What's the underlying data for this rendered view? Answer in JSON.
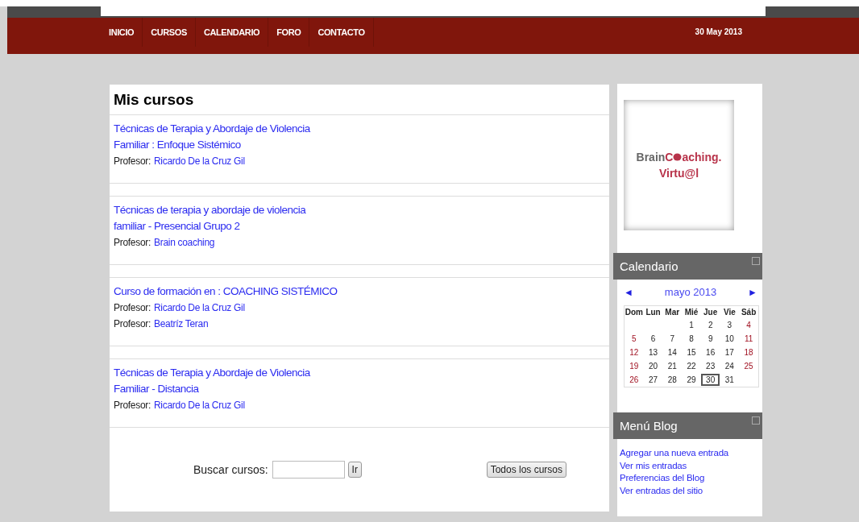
{
  "nav": {
    "items": [
      {
        "label": "INICIO"
      },
      {
        "label": "CURSOS"
      },
      {
        "label": "CALENDARIO"
      },
      {
        "label": "FORO"
      },
      {
        "label": "CONTACTO"
      }
    ],
    "date": "30 May 2013"
  },
  "courses": {
    "title": "Mis cursos",
    "items": [
      {
        "title_lines": [
          "Técnicas de Terapia y Abordaje de Violencia",
          "Familiar : Enfoque Sistémico"
        ],
        "teachers": [
          {
            "label": "Profesor:",
            "name": "Ricardo De la Cruz Gil"
          }
        ]
      },
      {
        "title_lines": [
          "Técnicas de terapia y abordaje de violencia",
          "familiar - Presencial Grupo 2"
        ],
        "teachers": [
          {
            "label": "Profesor:",
            "name": "Brain coaching"
          }
        ]
      },
      {
        "title_lines": [
          "Curso de formación en : COACHING SISTÉMICO"
        ],
        "teachers": [
          {
            "label": "Profesor:",
            "name": "Ricardo De la Cruz Gil"
          },
          {
            "label": "Profesor:",
            "name": "Beatríz Teran"
          }
        ]
      },
      {
        "title_lines": [
          "Técnicas de Terapia y Abordaje de Violencia",
          "Familiar - Distancia"
        ],
        "teachers": [
          {
            "label": "Profesor:",
            "name": "Ricardo De la Cruz Gil"
          }
        ]
      }
    ],
    "search": {
      "label": "Buscar cursos:",
      "button": "Ir"
    },
    "all_button": "Todos los cursos"
  },
  "logo": {
    "brand_start": "Brain",
    "brand_c": "C",
    "brand_rest": "aching",
    "brand_dot": ".",
    "line2": "Virtu@l"
  },
  "calendar": {
    "title": "Calendario",
    "prev": "◄",
    "month": "mayo 2013",
    "next": "►",
    "weekdays": [
      "Dom",
      "Lun",
      "Mar",
      "Mié",
      "Jue",
      "Vie",
      "Sáb"
    ],
    "weeks": [
      [
        {
          "day": "1",
          "today": false
        },
        {
          "day": "2",
          "today": false
        },
        {
          "day": "3",
          "today": false
        },
        {
          "day": "4",
          "today": false
        }
      ],
      [
        {
          "day": "5",
          "today": false
        },
        {
          "day": "6",
          "today": false
        },
        {
          "day": "7",
          "today": false
        },
        {
          "day": "8",
          "today": false
        },
        {
          "day": "9",
          "today": false
        },
        {
          "day": "10",
          "today": false
        },
        {
          "day": "11",
          "today": false
        }
      ],
      [
        {
          "day": "12",
          "today": false
        },
        {
          "day": "13",
          "today": false
        },
        {
          "day": "14",
          "today": false
        },
        {
          "day": "15",
          "today": false
        },
        {
          "day": "16",
          "today": false
        },
        {
          "day": "17",
          "today": false
        },
        {
          "day": "18",
          "today": false
        }
      ],
      [
        {
          "day": "19",
          "today": false
        },
        {
          "day": "20",
          "today": false
        },
        {
          "day": "21",
          "today": false
        },
        {
          "day": "22",
          "today": false
        },
        {
          "day": "23",
          "today": false
        },
        {
          "day": "24",
          "today": false
        },
        {
          "day": "25",
          "today": false
        }
      ],
      [
        {
          "day": "26",
          "today": false
        },
        {
          "day": "27",
          "today": false
        },
        {
          "day": "28",
          "today": false
        },
        {
          "day": "29",
          "today": false
        },
        {
          "day": "30",
          "today": true
        },
        {
          "day": "31",
          "today": false
        }
      ]
    ]
  },
  "blog": {
    "title": "Menú Blog",
    "links": [
      "Agregar una nueva entrada",
      "Ver mis entradas",
      "Preferencias del Blog",
      "Ver entradas del sitio"
    ]
  }
}
